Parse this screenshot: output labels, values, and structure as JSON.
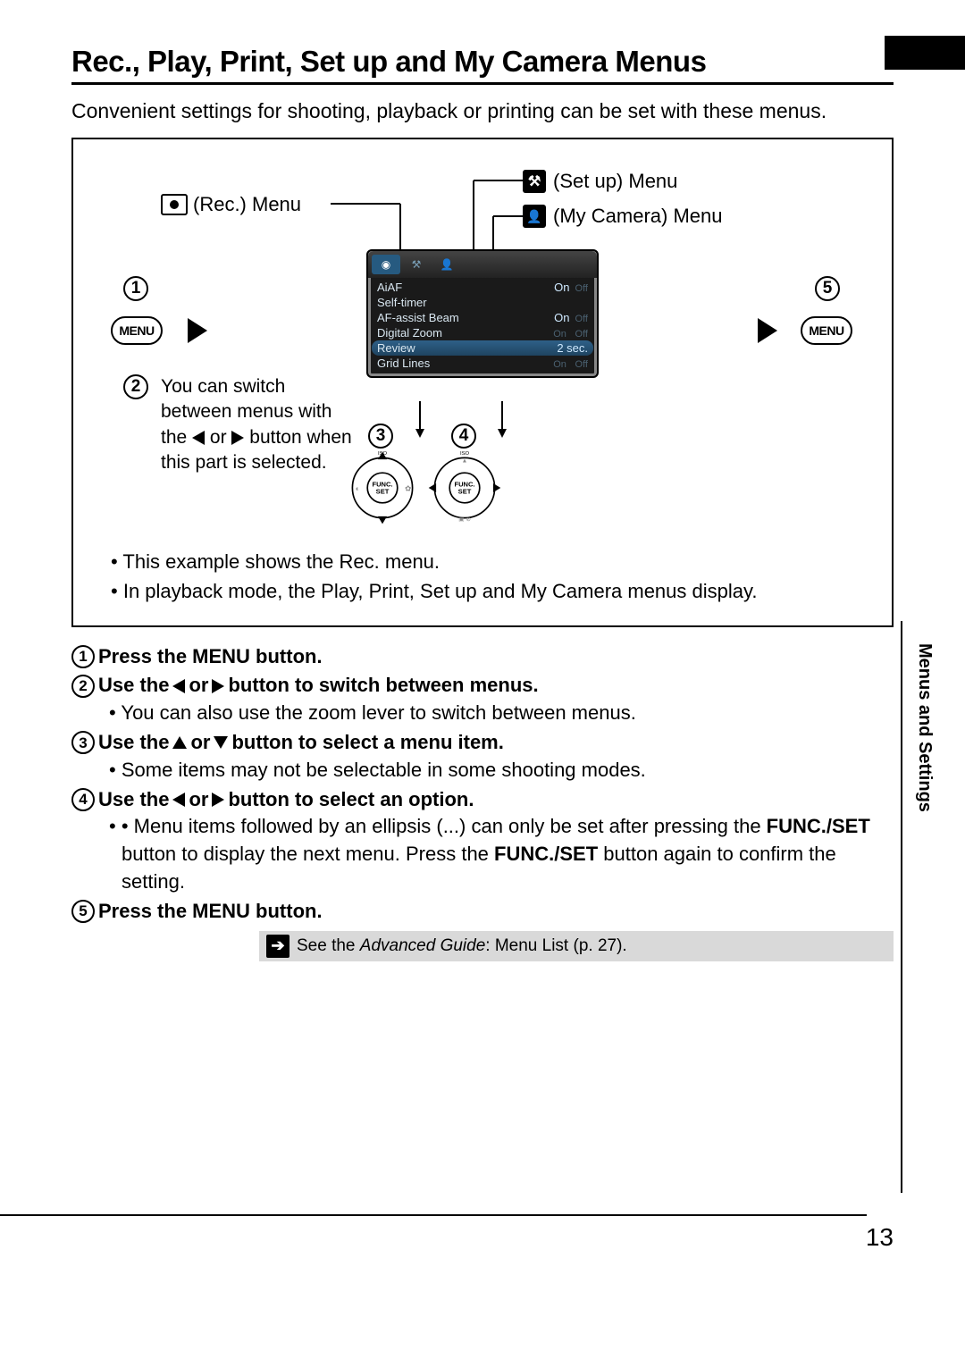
{
  "title": "Rec., Play, Print, Set up and My Camera Menus",
  "intro": "Convenient settings for shooting, playback or printing can be set with these menus.",
  "labels": {
    "rec_menu": "(Rec.) Menu",
    "setup_menu": "(Set up) Menu",
    "mycamera_menu": "(My Camera) Menu",
    "menu_button": "MENU"
  },
  "switch_text": {
    "line1": "You can switch between menus with the",
    "line1_mid": "or",
    "line2": "button when this part is selected."
  },
  "lcd": {
    "rows": [
      {
        "name": "AiAF",
        "value": "On",
        "dim": "Off"
      },
      {
        "name": "Self-timer",
        "value": "",
        "dim": ""
      },
      {
        "name": "AF-assist Beam",
        "value": "On",
        "dim": "Off"
      },
      {
        "name": "Digital Zoom",
        "value": "",
        "dim": "Off",
        "prefix": "On"
      },
      {
        "name": "Review",
        "value": "2 sec.",
        "dim": "",
        "highlight": true
      },
      {
        "name": "Grid Lines",
        "value": "",
        "dim": "Off",
        "prefix": "On"
      }
    ]
  },
  "diagram_notes": [
    "This example shows the Rec. menu.",
    "In playback mode, the Play, Print, Set up and My Camera menus display."
  ],
  "steps": {
    "s1": "Press the MENU button.",
    "s2": {
      "a": "Use the",
      "b": "or",
      "c": "button to switch between menus."
    },
    "s2_sub": "You can also use the zoom lever to switch between menus.",
    "s3": {
      "a": "Use the",
      "b": "or",
      "c": "button to select a menu item."
    },
    "s3_sub": "Some items may not be selectable in some shooting modes.",
    "s4": {
      "a": "Use the",
      "b": "or",
      "c": "button to select an option."
    },
    "s4_sub": {
      "a": "Menu items followed by an ellipsis (...) can only be set after pressing the ",
      "b": "FUNC./SET",
      "c": " button to display the next menu. Press the ",
      "d": "FUNC./SET",
      "e": " button again to confirm the setting."
    },
    "s5": "Press the MENU button."
  },
  "adv_note": {
    "a": "See the ",
    "b": "Advanced Guide",
    "c": ": Menu List (p. 27)."
  },
  "side_tab": "Menus and Settings",
  "page_number": "13",
  "funcset": "FUNC.\nSET",
  "iso_label": "ISO"
}
